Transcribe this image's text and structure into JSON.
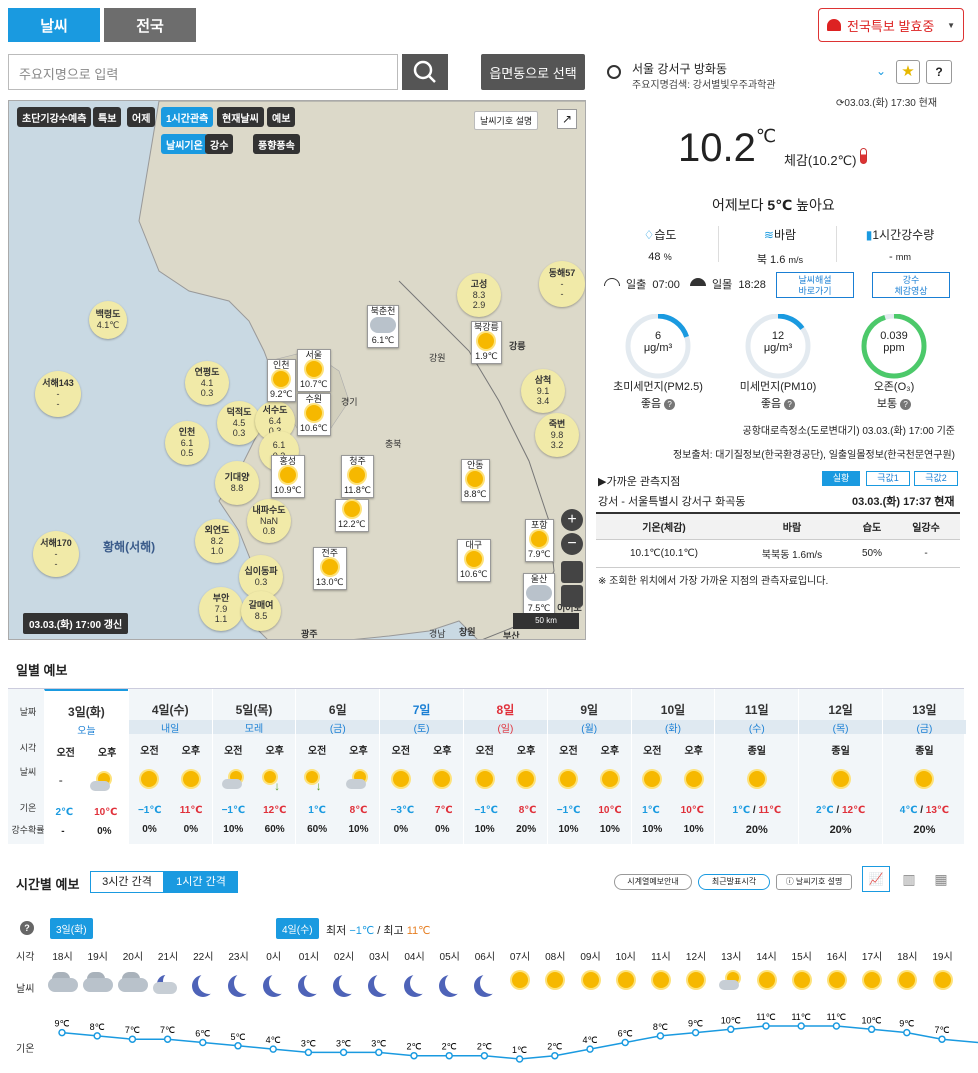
{
  "tabs": {
    "weather": "날씨",
    "nation": "전국"
  },
  "alert_button": "전국특보 발효중",
  "search": {
    "placeholder": "주요지명으로 입력",
    "emd_button": "읍면동으로 선택"
  },
  "map": {
    "buttons_row1": [
      "초단기강수예측",
      "특보",
      "어제",
      "1시간관측",
      "현재날씨",
      "예보"
    ],
    "buttons_row2": [
      "날씨기온",
      "강수",
      "풍향풍속"
    ],
    "legend_help": "날씨기호 설명",
    "update_time": "03.03.(화) 17:00 갱신",
    "scale": "50 km",
    "sea_label": "황해(서해)",
    "region_labels": [
      "경기",
      "강원",
      "충북",
      "경남"
    ],
    "stations": [
      {
        "name": "백령도",
        "temp": "4.1℃"
      },
      {
        "name": "서해143",
        "wind": "-",
        "unit": "m/s",
        "wave": "-",
        "wunit": "m"
      },
      {
        "name": "연평도",
        "wind": "4.1",
        "unit": "m/s",
        "wave": "0.3",
        "wunit": "m"
      },
      {
        "name": "인천",
        "wind": "6.1",
        "unit": "m/s",
        "wave": "0.5",
        "wunit": "m"
      },
      {
        "name": "덕적도",
        "wind": "4.5",
        "unit": "m/s",
        "wave": "0.3",
        "wunit": "m"
      },
      {
        "name": "서수도",
        "wind": "6.4",
        "unit": "m/s",
        "wave": "0.3",
        "wunit": "m"
      },
      {
        "name": "",
        "wind": "6.1",
        "unit": "m/s",
        "wave": "0.2",
        "wunit": "m"
      },
      {
        "name": "기대양",
        "wind": "8.8",
        "unit": "m/s"
      },
      {
        "name": "내파수도",
        "wind": "NaN",
        "unit": "m/s",
        "wave": "0.8",
        "wunit": "m"
      },
      {
        "name": "서해170",
        "wind": "-",
        "unit": "m/s",
        "wave": "-",
        "wunit": "m"
      },
      {
        "name": "외연도",
        "wind": "8.2",
        "unit": "m/s",
        "wave": "1.0",
        "wunit": "m"
      },
      {
        "name": "십이동파",
        "wind": "0.3",
        "unit": "m/s"
      },
      {
        "name": "부안",
        "wind": "7.9",
        "unit": "m/s",
        "wave": "1.1",
        "wunit": "m"
      },
      {
        "name": "갈매여",
        "wind": "8.5",
        "unit": "m/s"
      },
      {
        "name": "고성",
        "wind": "8.3",
        "unit": "m/s",
        "wave": "2.9",
        "wunit": "m"
      },
      {
        "name": "동해57",
        "wind": "-",
        "unit": "m/s",
        "wave": "-",
        "wunit": "m"
      },
      {
        "name": "삼척",
        "wind": "9.1",
        "unit": "m/s",
        "wave": "3.4",
        "wunit": "m"
      },
      {
        "name": "죽변",
        "wind": "9.8",
        "unit": "m/s",
        "wave": "3.2",
        "wunit": "m"
      }
    ],
    "cities": [
      {
        "name": "북춘천",
        "temp": "6.1℃"
      },
      {
        "name": "북강릉",
        "temp": "1.9℃"
      },
      {
        "name": "강릉",
        "temp": ""
      },
      {
        "name": "인천",
        "temp": "9.2℃"
      },
      {
        "name": "서울",
        "temp": "10.7℃"
      },
      {
        "name": "수원",
        "temp": "10.6℃"
      },
      {
        "name": "홍성",
        "temp": "10.9℃"
      },
      {
        "name": "청주",
        "temp": "11.8℃"
      },
      {
        "name": "",
        "temp": "12.2℃"
      },
      {
        "name": "안동",
        "temp": "8.8℃"
      },
      {
        "name": "전주",
        "temp": "13.0℃"
      },
      {
        "name": "대구",
        "temp": "10.6℃"
      },
      {
        "name": "포항",
        "temp": "7.9℃"
      },
      {
        "name": "울산",
        "temp": "7.5℃"
      },
      {
        "name": "광주",
        "temp": ""
      },
      {
        "name": "창원",
        "temp": ""
      },
      {
        "name": "부산",
        "temp": ""
      },
      {
        "name": "이어도",
        "temp": ""
      }
    ]
  },
  "location": {
    "name": "서울 강서구 방화동",
    "sub": "주요지명검색: 강서별빛우주과학관",
    "time": "03.03.(화) 17:30 현재"
  },
  "current": {
    "temp": "10.2",
    "unit": "℃",
    "feels": "체감(10.2℃)",
    "compare_prefix": "어제보다 ",
    "compare_value": "5℃",
    "compare_suffix": " 높아요",
    "humidity_label": "습도",
    "humidity": "48",
    "humidity_unit": "%",
    "wind_label": "바람",
    "wind": "북 1.6",
    "wind_unit": "m/s",
    "rain_label": "1시간강수량",
    "rain": "-",
    "rain_unit": "mm",
    "sunrise_label": "일출",
    "sunrise": "07:00",
    "sunset_label": "일몰",
    "sunset": "18:28",
    "btn_commentary": "날씨해설\n바로가기",
    "btn_rain": "강수\n체감영상"
  },
  "air": {
    "items": [
      {
        "value": "6",
        "unit": "μg/m³",
        "name": "초미세먼지(PM2.5)",
        "grade": "좋음",
        "fill": 0.2
      },
      {
        "value": "12",
        "unit": "μg/m³",
        "name": "미세먼지(PM10)",
        "grade": "좋음",
        "fill": 0.15
      },
      {
        "value": "0.039",
        "unit": "ppm",
        "name": "오존(O₃)",
        "grade": "보통",
        "fill": 0.95
      }
    ],
    "station": "공항대로측정소(도로변대기) 03.03.(화) 17:00 기준",
    "source": "정보출처: 대기질정보(한국환경공단), 일출일몰정보(한국천문연구원)"
  },
  "nearby": {
    "title": "▶가까운 관측지점",
    "tabs": [
      "실황",
      "극값1",
      "극값2"
    ],
    "location": "강서 - 서울특별시 강서구 화곡동",
    "time": "03.03.(화) 17:37 현재",
    "headers": [
      "기온(체감)",
      "바람",
      "습도",
      "일강수"
    ],
    "values": [
      "10.1℃(10.1℃)",
      "북북동 1.6m/s",
      "50%",
      "-"
    ],
    "note": "※ 조회한 위치에서 가장 가까운 지점의 관측자료입니다."
  },
  "daily": {
    "title": "일별 예보",
    "row_labels": [
      "날짜",
      "시각",
      "날씨",
      "기온",
      "강수확률"
    ],
    "days": [
      {
        "d": "3일(화)",
        "sub": "오늘",
        "am": "오전",
        "pm": "오후",
        "tam": "2℃",
        "tpm": "10℃",
        "pam": "-",
        "ppm": "0%",
        "wam": "none",
        "wpm": "partly"
      },
      {
        "d": "4일(수)",
        "sub": "내일",
        "am": "오전",
        "pm": "오후",
        "tam": "−1℃",
        "tpm": "11℃",
        "pam": "0%",
        "ppm": "0%",
        "wam": "sun",
        "wpm": "sun"
      },
      {
        "d": "5일(목)",
        "sub": "모레",
        "am": "오전",
        "pm": "오후",
        "tam": "−1℃",
        "tpm": "12℃",
        "pam": "10%",
        "ppm": "60%",
        "wam": "partly",
        "wpm": "rain"
      },
      {
        "d": "6일",
        "sub": "(금)",
        "am": "오전",
        "pm": "오후",
        "tam": "1℃",
        "tpm": "8℃",
        "pam": "60%",
        "ppm": "10%",
        "wam": "rain",
        "wpm": "partly"
      },
      {
        "d": "7일",
        "sub": "(토)",
        "am": "오전",
        "pm": "오후",
        "tam": "−3℃",
        "tpm": "7℃",
        "pam": "0%",
        "ppm": "0%",
        "wam": "sun",
        "wpm": "sun",
        "color": "#1a7fd4"
      },
      {
        "d": "8일",
        "sub": "(일)",
        "am": "오전",
        "pm": "오후",
        "tam": "−1℃",
        "tpm": "8℃",
        "pam": "10%",
        "ppm": "20%",
        "wam": "sun",
        "wpm": "sun",
        "color": "#e0303a"
      },
      {
        "d": "9일",
        "sub": "(월)",
        "am": "오전",
        "pm": "오후",
        "tam": "−1℃",
        "tpm": "10℃",
        "pam": "10%",
        "ppm": "10%",
        "wam": "sun",
        "wpm": "sun"
      },
      {
        "d": "10일",
        "sub": "(화)",
        "am": "오전",
        "pm": "오후",
        "tam": "1℃",
        "tpm": "10℃",
        "pam": "10%",
        "ppm": "10%",
        "wam": "sun",
        "wpm": "sun"
      },
      {
        "d": "11일",
        "sub": "(수)",
        "all": "종일",
        "tam": "1℃",
        "tpm": "11℃",
        "pall": "20%",
        "wall": "sun"
      },
      {
        "d": "12일",
        "sub": "(목)",
        "all": "종일",
        "tam": "2℃",
        "tpm": "12℃",
        "pall": "20%",
        "wall": "sun"
      },
      {
        "d": "13일",
        "sub": "(금)",
        "all": "종일",
        "tam": "4℃",
        "tpm": "13℃",
        "pall": "20%",
        "wall": "sun"
      }
    ]
  },
  "hourly": {
    "title": "시간별 예보",
    "tab3": "3시간 간격",
    "tab1": "1시간 간격",
    "btn_info": "시계열예보안내",
    "btn_latest": "최근발표시각",
    "btn_legend": "날씨기호 설명",
    "day1": "3일(화)",
    "day2": "4일(수)",
    "minmax_min_label": "최저",
    "min": "−1℃",
    "minmax_max_label": "최고",
    "max": "11℃",
    "row_time": "시각",
    "row_weather": "날씨",
    "row_temp": "기온",
    "hours": [
      "18시",
      "19시",
      "20시",
      "21시",
      "22시",
      "23시",
      "0시",
      "01시",
      "02시",
      "03시",
      "04시",
      "05시",
      "06시",
      "07시",
      "08시",
      "09시",
      "10시",
      "11시",
      "12시",
      "13시",
      "14시",
      "15시",
      "16시",
      "17시",
      "18시",
      "19시"
    ],
    "icons": [
      "cloud",
      "cloud",
      "cloud",
      "mooncloud",
      "moon",
      "moon",
      "moon",
      "moon",
      "moon",
      "moon",
      "moon",
      "moon",
      "moon",
      "sun",
      "sun",
      "sun",
      "sun",
      "sun",
      "sun",
      "partly",
      "sun",
      "sun",
      "sun",
      "sun",
      "sun",
      "sun"
    ],
    "temps": [
      9,
      8,
      7,
      7,
      6,
      5,
      4,
      3,
      3,
      3,
      2,
      2,
      2,
      1,
      2,
      4,
      6,
      8,
      9,
      10,
      11,
      11,
      11,
      10,
      9,
      7
    ]
  },
  "colors": {
    "accent": "#1a9ae0",
    "tab_inactive": "#6d6d6d",
    "line": "#1a9ae0",
    "sun": "#f6b800",
    "moon": "#4e63b8"
  }
}
